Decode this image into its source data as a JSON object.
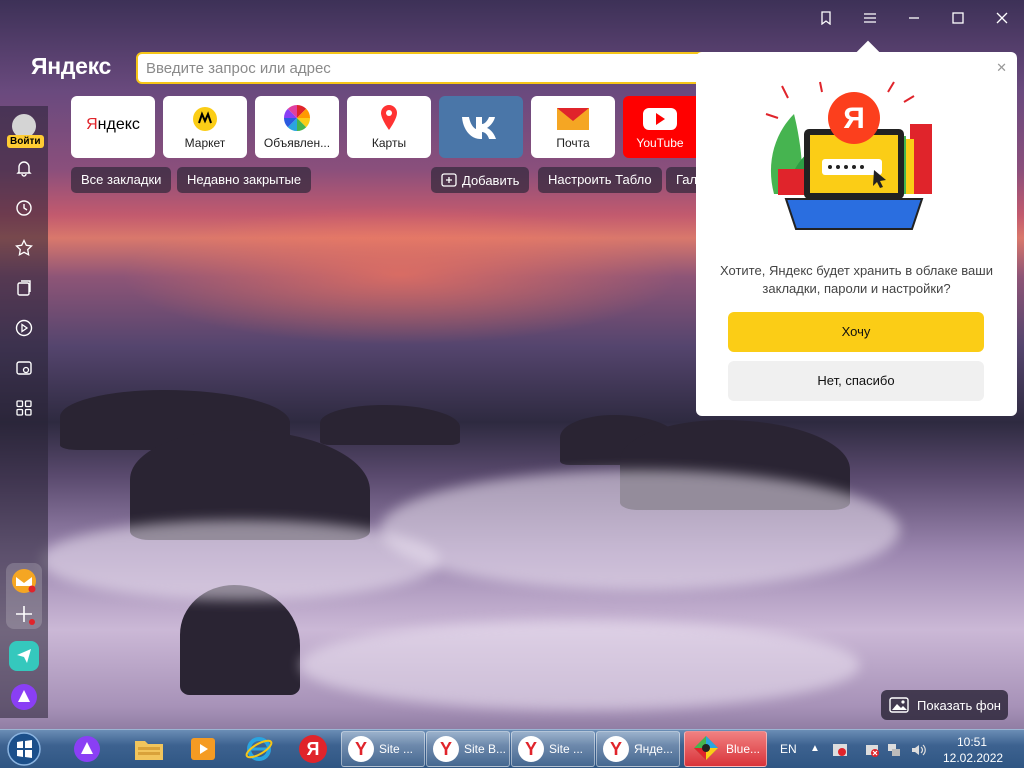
{
  "window": {
    "controls": [
      "bookmarks-icon",
      "menu-icon",
      "minimize-icon",
      "maximize-icon",
      "close-icon"
    ]
  },
  "browser": {
    "logo": "Яндекс"
  },
  "address_bar": {
    "placeholder": "Введите запрос или адрес"
  },
  "sidebar": {
    "login_label": "Войти"
  },
  "tiles": [
    {
      "label": "Яндекс",
      "name": "tile-yandex"
    },
    {
      "label": "Маркет",
      "name": "tile-market"
    },
    {
      "label": "Объявлен...",
      "name": "tile-ads"
    },
    {
      "label": "Карты",
      "name": "tile-maps"
    },
    {
      "label": "",
      "name": "tile-vk"
    },
    {
      "label": "Почта",
      "name": "tile-mail"
    },
    {
      "label": "YouTube",
      "name": "tile-youtube"
    }
  ],
  "chips": {
    "bookmarks": "Все закладки",
    "recent": "Недавно закрытые",
    "add": "Добавить",
    "customize": "Настроить Табло",
    "gallery": "Гал"
  },
  "popup": {
    "text": "Хотите, Яндекс будет хранить в облаке ваши закладки, пароли и настройки?",
    "yes": "Хочу",
    "no": "Нет, спасибо",
    "brand_letter": "Я"
  },
  "show_background": "Показать фон",
  "taskbar": {
    "items": [
      {
        "label": "Site ..."
      },
      {
        "label": "Site B..."
      },
      {
        "label": "Site ..."
      },
      {
        "label": "Янде..."
      },
      {
        "label": "Blue..."
      }
    ],
    "lang": "EN",
    "time": "10:51",
    "date": "12.02.2022"
  },
  "colors": {
    "accent": "#fbcd16",
    "brand_red": "#fc3f1d",
    "vk": "#4a76a8",
    "youtube": "#ff0000"
  }
}
